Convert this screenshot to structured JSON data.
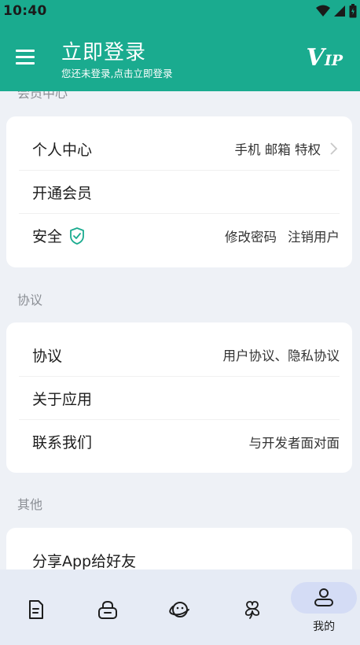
{
  "status_bar": {
    "time": "10:40"
  },
  "header": {
    "title": "立即登录",
    "subtitle": "您还未登录,点击立即登录",
    "vip_v": "V",
    "vip_ip": "IP"
  },
  "sections": {
    "member": {
      "title": "会员中心",
      "rows": [
        {
          "label": "个人中心",
          "value_1": "手机 邮箱 特权"
        },
        {
          "label": "开通会员"
        },
        {
          "label": "安全",
          "value_1": "修改密码",
          "value_2": "注销用户"
        }
      ]
    },
    "agreement": {
      "title": "协议",
      "rows": [
        {
          "label": "协议",
          "value_1": "用户协议、隐私协议"
        },
        {
          "label": "关于应用"
        },
        {
          "label": "联系我们",
          "value_1": "与开发者面对面"
        }
      ]
    },
    "other": {
      "title": "其他",
      "rows": [
        {
          "label": "分享App给好友"
        }
      ]
    }
  },
  "bottom_nav": {
    "items": [
      {
        "icon": "document-icon"
      },
      {
        "icon": "lock-icon"
      },
      {
        "icon": "planet-icon"
      },
      {
        "icon": "clover-icon"
      },
      {
        "icon": "person-icon",
        "label": "我的",
        "active": true
      }
    ]
  },
  "colors": {
    "primary": "#1aab8f",
    "background": "#eef1f6",
    "nav_bg": "#e6ebf5",
    "active_pill": "#d4dcf5"
  }
}
